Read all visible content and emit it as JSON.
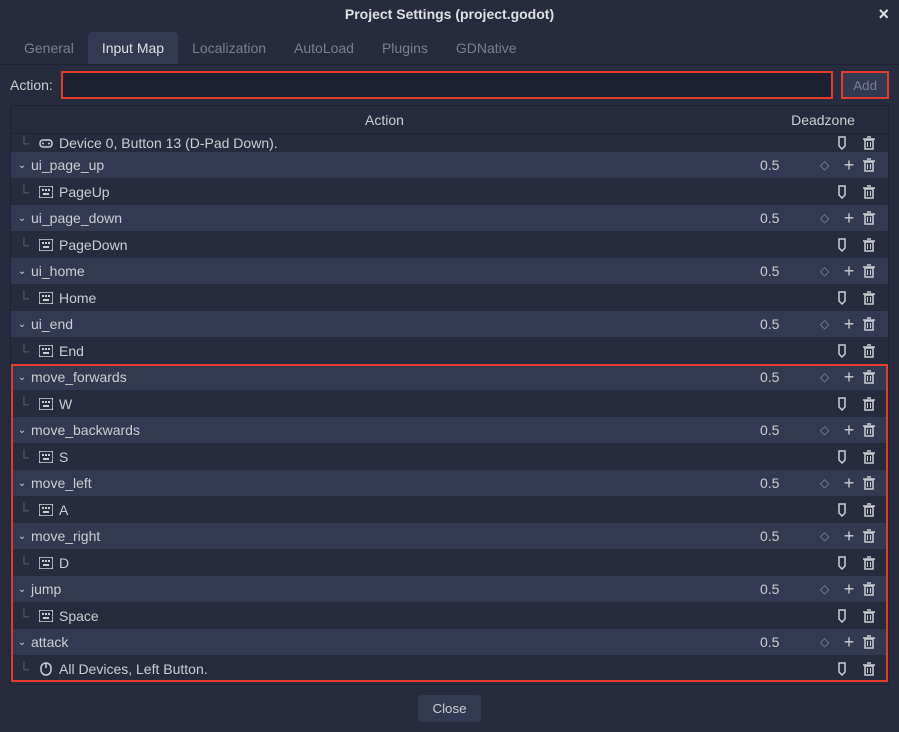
{
  "window": {
    "title": "Project Settings (project.godot)"
  },
  "tabs": {
    "items": [
      "General",
      "Input Map",
      "Localization",
      "AutoLoad",
      "Plugins",
      "GDNative"
    ],
    "active": 1
  },
  "action_bar": {
    "label": "Action:",
    "value": "",
    "add_label": "Add"
  },
  "headers": {
    "action": "Action",
    "deadzone": "Deadzone"
  },
  "partial_event": {
    "label": "Device 0, Button 13 (D-Pad Down)."
  },
  "actions": [
    {
      "name": "ui_page_up",
      "deadzone": "0.5",
      "events": [
        {
          "type": "key",
          "label": "PageUp"
        }
      ],
      "hl": false
    },
    {
      "name": "ui_page_down",
      "deadzone": "0.5",
      "events": [
        {
          "type": "key",
          "label": "PageDown"
        }
      ],
      "hl": false
    },
    {
      "name": "ui_home",
      "deadzone": "0.5",
      "events": [
        {
          "type": "key",
          "label": "Home"
        }
      ],
      "hl": false
    },
    {
      "name": "ui_end",
      "deadzone": "0.5",
      "events": [
        {
          "type": "key",
          "label": "End"
        }
      ],
      "hl": false
    },
    {
      "name": "move_forwards",
      "deadzone": "0.5",
      "events": [
        {
          "type": "key",
          "label": "W"
        }
      ],
      "hl": true
    },
    {
      "name": "move_backwards",
      "deadzone": "0.5",
      "events": [
        {
          "type": "key",
          "label": "S"
        }
      ],
      "hl": true
    },
    {
      "name": "move_left",
      "deadzone": "0.5",
      "events": [
        {
          "type": "key",
          "label": "A"
        }
      ],
      "hl": true
    },
    {
      "name": "move_right",
      "deadzone": "0.5",
      "events": [
        {
          "type": "key",
          "label": "D"
        }
      ],
      "hl": true
    },
    {
      "name": "jump",
      "deadzone": "0.5",
      "events": [
        {
          "type": "key",
          "label": "Space"
        }
      ],
      "hl": true
    },
    {
      "name": "attack",
      "deadzone": "0.5",
      "events": [
        {
          "type": "mouse",
          "label": "All Devices, Left Button."
        }
      ],
      "hl": true
    }
  ],
  "footer": {
    "close": "Close"
  }
}
